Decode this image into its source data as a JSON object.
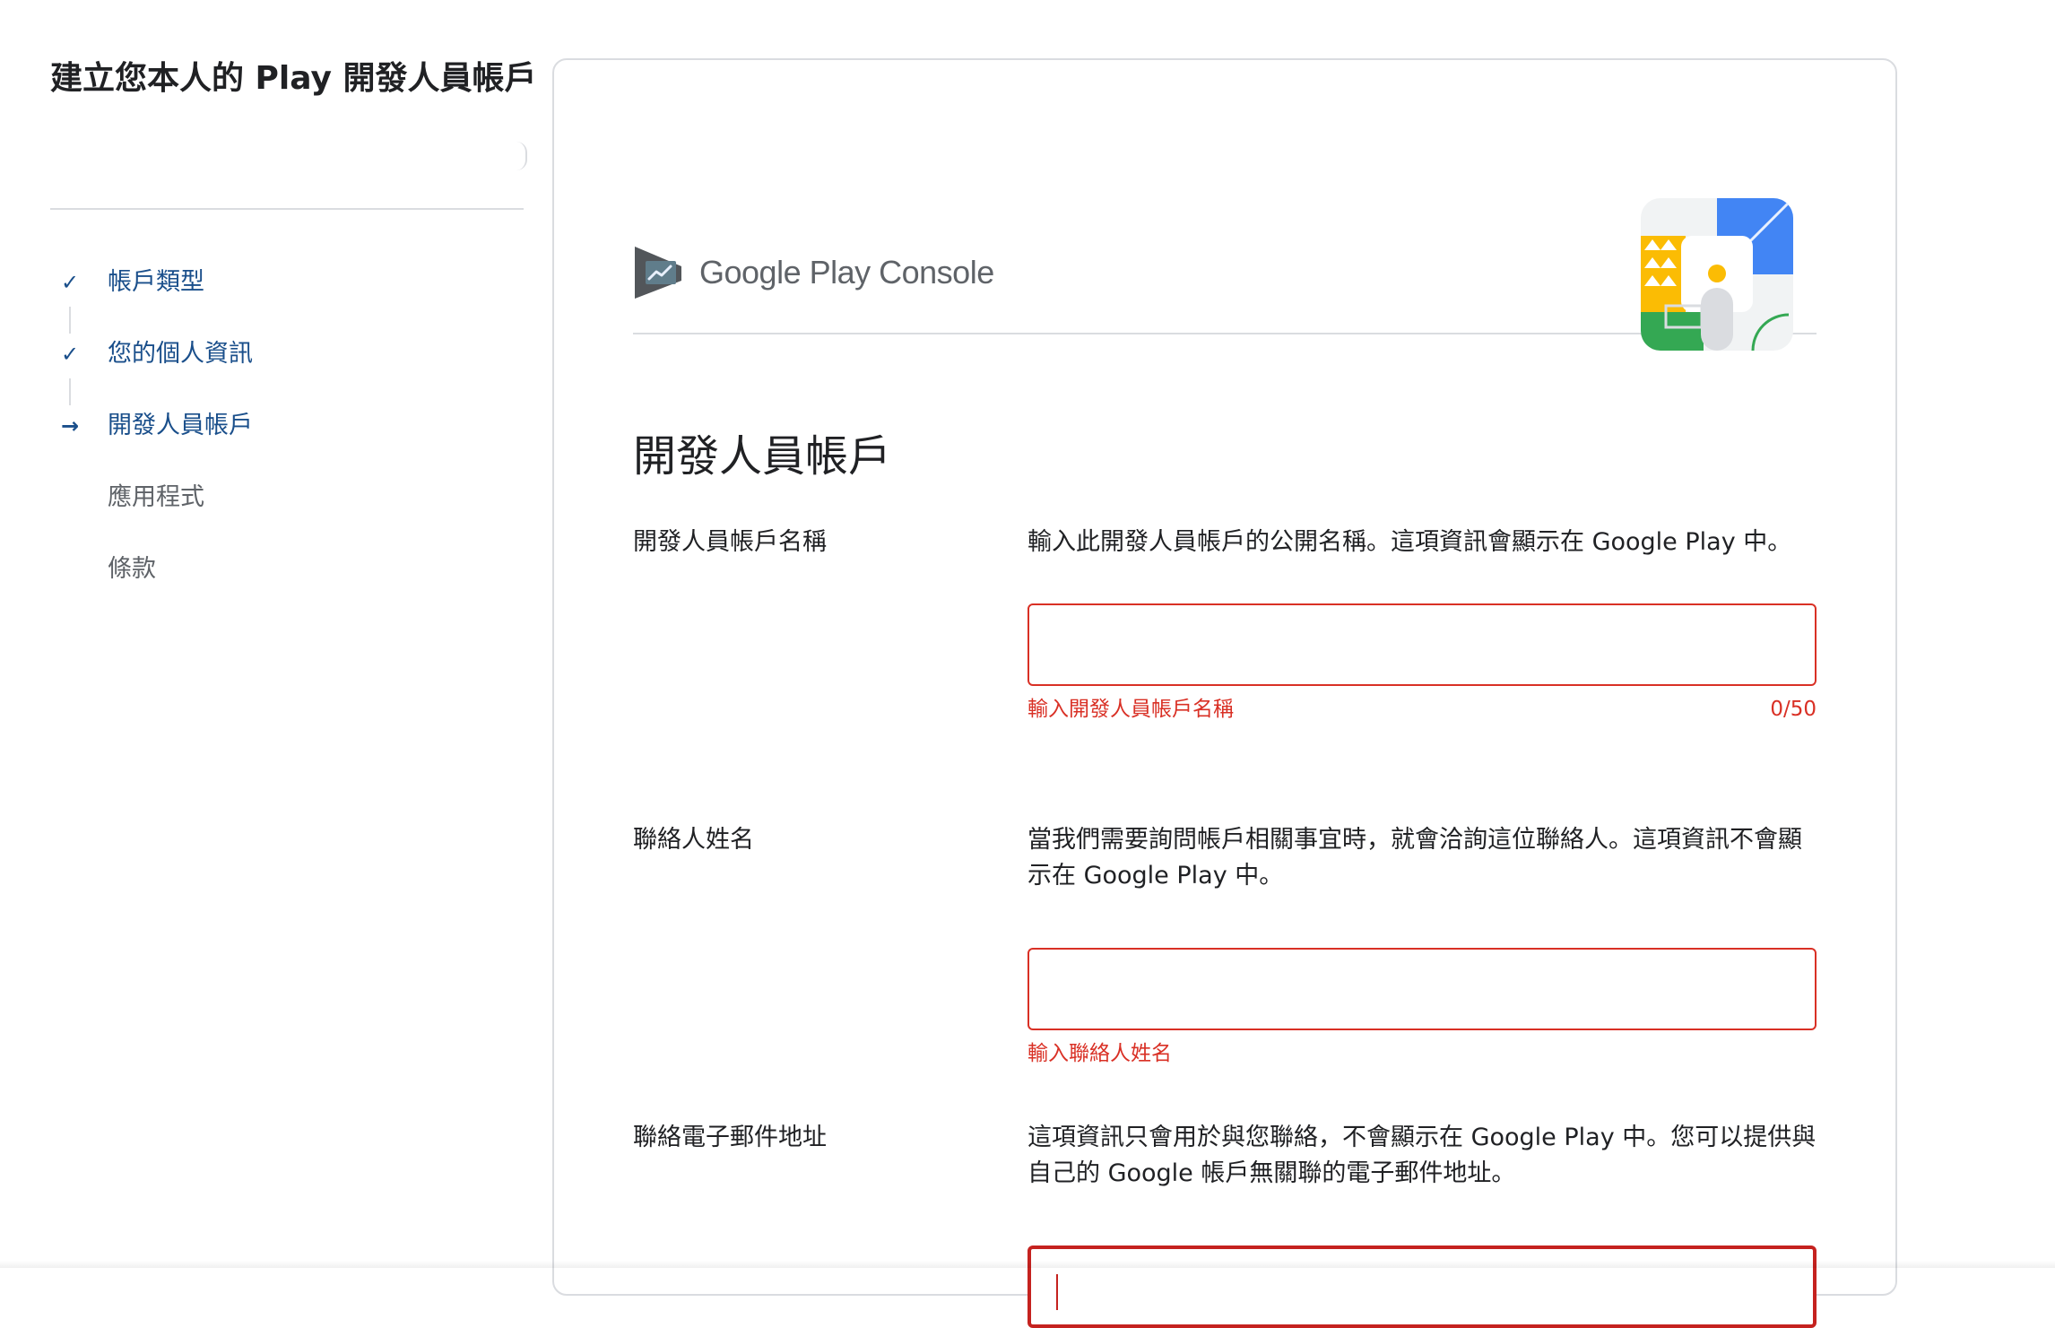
{
  "sidebar": {
    "title": "建立您本人的 Play 開發人員帳戶",
    "steps": [
      {
        "label": "帳戶類型",
        "state": "done",
        "icon": "check-icon"
      },
      {
        "label": "您的個人資訊",
        "state": "done",
        "icon": "check-icon"
      },
      {
        "label": "開發人員帳戶",
        "state": "current",
        "icon": "arrow-right-icon"
      },
      {
        "label": "應用程式",
        "state": "pending",
        "icon": ""
      },
      {
        "label": "條款",
        "state": "pending",
        "icon": ""
      }
    ],
    "step_icons": {
      "check": "✓",
      "arrow": "→"
    }
  },
  "header": {
    "brand_google_play": "Google Play",
    "brand_console": "Console",
    "logo_icon": "play-console-logo-icon",
    "illustration": "developer-account-illustration"
  },
  "section": {
    "title": "開發人員帳戶"
  },
  "fields": {
    "developer_name": {
      "label": "開發人員帳戶名稱",
      "description": "輸入此開發人員帳戶的公開名稱。這項資訊會顯示在 Google Play 中。",
      "value": "",
      "error": "輸入開發人員帳戶名稱",
      "counter": "0/50"
    },
    "contact_name": {
      "label": "聯絡人姓名",
      "description": "當我們需要詢問帳戶相關事宜時，就會洽詢這位聯絡人。這項資訊不會顯示在 Google Play 中。",
      "value": "",
      "error": "輸入聯絡人姓名"
    },
    "contact_email": {
      "label": "聯絡電子郵件地址",
      "description": "這項資訊只會用於與您聯絡，不會顯示在 Google Play 中。您可以提供與自己的 Google 帳戶無關聯的電子郵件地址。",
      "value": ""
    }
  },
  "colors": {
    "accent": "#1a4f8b",
    "error": "#d93025",
    "divider": "#dadce0",
    "text": "#202124",
    "muted": "#5f6368"
  }
}
